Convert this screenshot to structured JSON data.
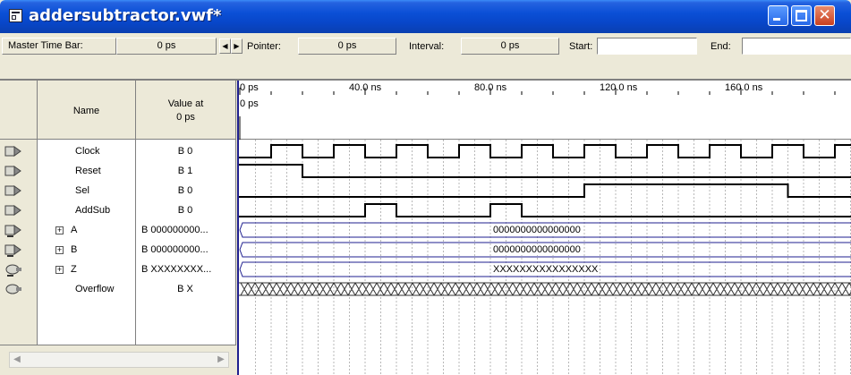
{
  "window": {
    "title": "addersubtractor.vwf*"
  },
  "timebar": {
    "master_label": "Master Time Bar:",
    "master_value": "0 ps",
    "pointer_label": "Pointer:",
    "pointer_value": "0 ps",
    "interval_label": "Interval:",
    "interval_value": "0 ps",
    "start_label": "Start:",
    "start_value": "",
    "end_label": "End:",
    "end_value": ""
  },
  "columns": {
    "name": "Name",
    "value_line1": "Value at",
    "value_line2": "0 ps"
  },
  "ruler": {
    "ticks": [
      "0 ps",
      "40.0 ns",
      "80.0 ns",
      "120.0 ns",
      "160.0 ns"
    ],
    "cursor_label": "0 ps"
  },
  "signals": [
    {
      "name": "Clock",
      "value": "B 0",
      "kind": "input",
      "expandable": false
    },
    {
      "name": "Reset",
      "value": "B 1",
      "kind": "input",
      "expandable": false
    },
    {
      "name": "Sel",
      "value": "B 0",
      "kind": "input",
      "expandable": false
    },
    {
      "name": "AddSub",
      "value": "B 0",
      "kind": "input",
      "expandable": false
    },
    {
      "name": "A",
      "value": "B 000000000...",
      "kind": "input-bus",
      "expandable": true
    },
    {
      "name": "B",
      "value": "B 000000000...",
      "kind": "input-bus",
      "expandable": true
    },
    {
      "name": "Z",
      "value": "B XXXXXXXX...",
      "kind": "output-bus",
      "expandable": true
    },
    {
      "name": "Overflow",
      "value": "B X",
      "kind": "output",
      "expandable": false
    }
  ],
  "waveforms": {
    "A_value": "0000000000000000",
    "B_value": "0000000000000000",
    "Z_value": "XXXXXXXXXXXXXXXX"
  },
  "colors": {
    "title_bar": "#0a4fd6",
    "wave_line": "#000000",
    "bus_line": "#1f1f8f",
    "grid": "#b8b8b8"
  }
}
